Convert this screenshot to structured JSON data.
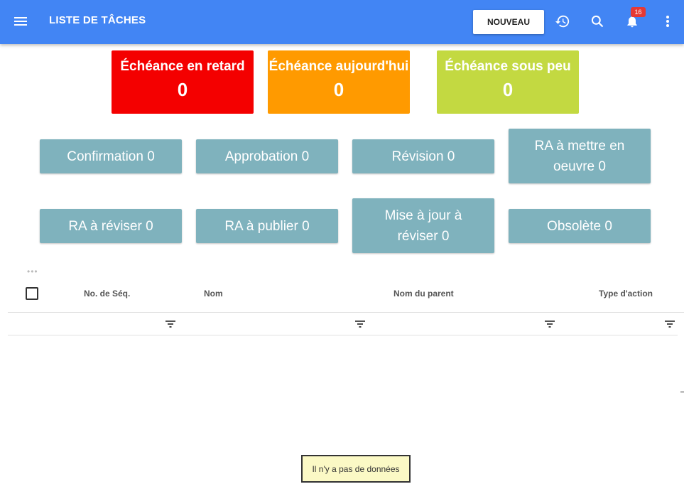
{
  "header": {
    "title": "LISTE DE TÂCHES",
    "new_label": "NOUVEAU",
    "notification_count": "16",
    "color": "#4285f4"
  },
  "cards": [
    {
      "label": "Échéance en retard",
      "value": "0",
      "color": "#f40000"
    },
    {
      "label": "Échéance aujourd'hui",
      "value": "0",
      "color": "#ff9a00"
    },
    {
      "label": "Échéance sous peu",
      "value": "0",
      "color": "#c3d941"
    }
  ],
  "task_buttons": [
    {
      "line1": "Confirmation 0",
      "line2": ""
    },
    {
      "line1": "Approbation 0",
      "line2": ""
    },
    {
      "line1": "Révision 0",
      "line2": ""
    },
    {
      "line1": "RA à mettre en",
      "line2": "oeuvre 0"
    },
    {
      "line1": "RA à réviser 0",
      "line2": ""
    },
    {
      "line1": "RA à publier 0",
      "line2": ""
    },
    {
      "line1": "Mise à jour à",
      "line2": "réviser 0"
    },
    {
      "line1": "Obsolète 0",
      "line2": ""
    }
  ],
  "table": {
    "columns": [
      "No. de Séq.",
      "Nom",
      "Nom du parent",
      "Type d'action"
    ],
    "empty_message": "Il n'y a pas de données"
  },
  "icons": {
    "menu": "menu-icon",
    "history": "history-icon",
    "search": "search-icon",
    "notifications": "bell-icon",
    "more": "more-vert-icon",
    "filter": "filter-icon"
  }
}
